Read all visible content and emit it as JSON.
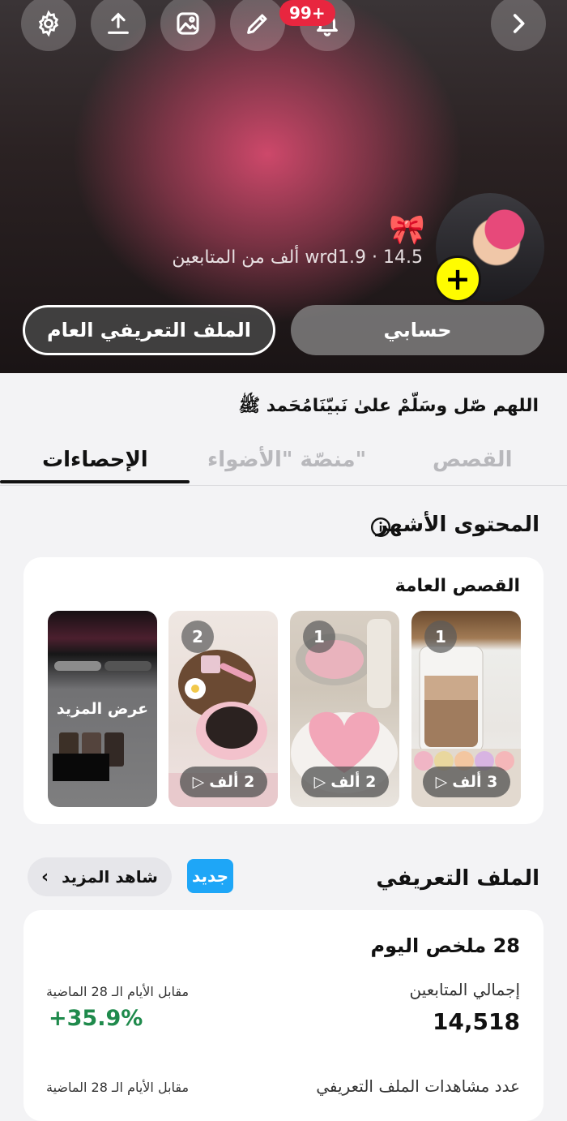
{
  "header": {
    "notifications_badge": "99+",
    "icons": [
      "settings-icon",
      "upload-icon",
      "gallery-icon",
      "edit-icon",
      "bell-icon",
      "chevron-right-icon"
    ]
  },
  "profile": {
    "subscribers_text": "wrd1.9 · 14.5 ألف من المتابعين",
    "bow_emoji": "🎀",
    "add_symbol": "+",
    "public_profile_label": "الملف التعريفي العام",
    "my_account_label": "حسابي"
  },
  "bio": "اللهم صّل وسَلّمْ علىٰ نَبيّنَامُحَمد ﷺ",
  "tabs": {
    "stats": "الإحصاءات",
    "spotlight": "منصّة \"الأضواء\"",
    "stories": "القصص"
  },
  "top_content": {
    "title": "المحتوى الأشهر",
    "card_title": "القصص العامة",
    "stories": [
      {
        "num": "1",
        "views": "3 ألف"
      },
      {
        "num": "1",
        "views": "2 ألف"
      },
      {
        "num": "2",
        "views": "2 ألف"
      }
    ],
    "see_more_tile": "عرض المزيد"
  },
  "profile_section": {
    "title": "الملف التعريفي",
    "new_badge": "جديد",
    "see_more": "شاهد المزيد",
    "summary_title": "28 ملخص اليوم",
    "followers_label": "إجمالي المتابعين",
    "followers_value": "14,518",
    "compare_label": "مقابل الأيام الـ 28 الماضية",
    "change_value": "+35.9%",
    "views_label": "عدد مشاهدات الملف التعريفي",
    "compare_label_2": "مقابل الأيام الـ 28 الماضية"
  },
  "colors": {
    "accent_yellow": "#fffc00",
    "badge_red": "#e8263f",
    "new_blue": "#1ea6f7",
    "positive_green": "#1f8a4c"
  }
}
